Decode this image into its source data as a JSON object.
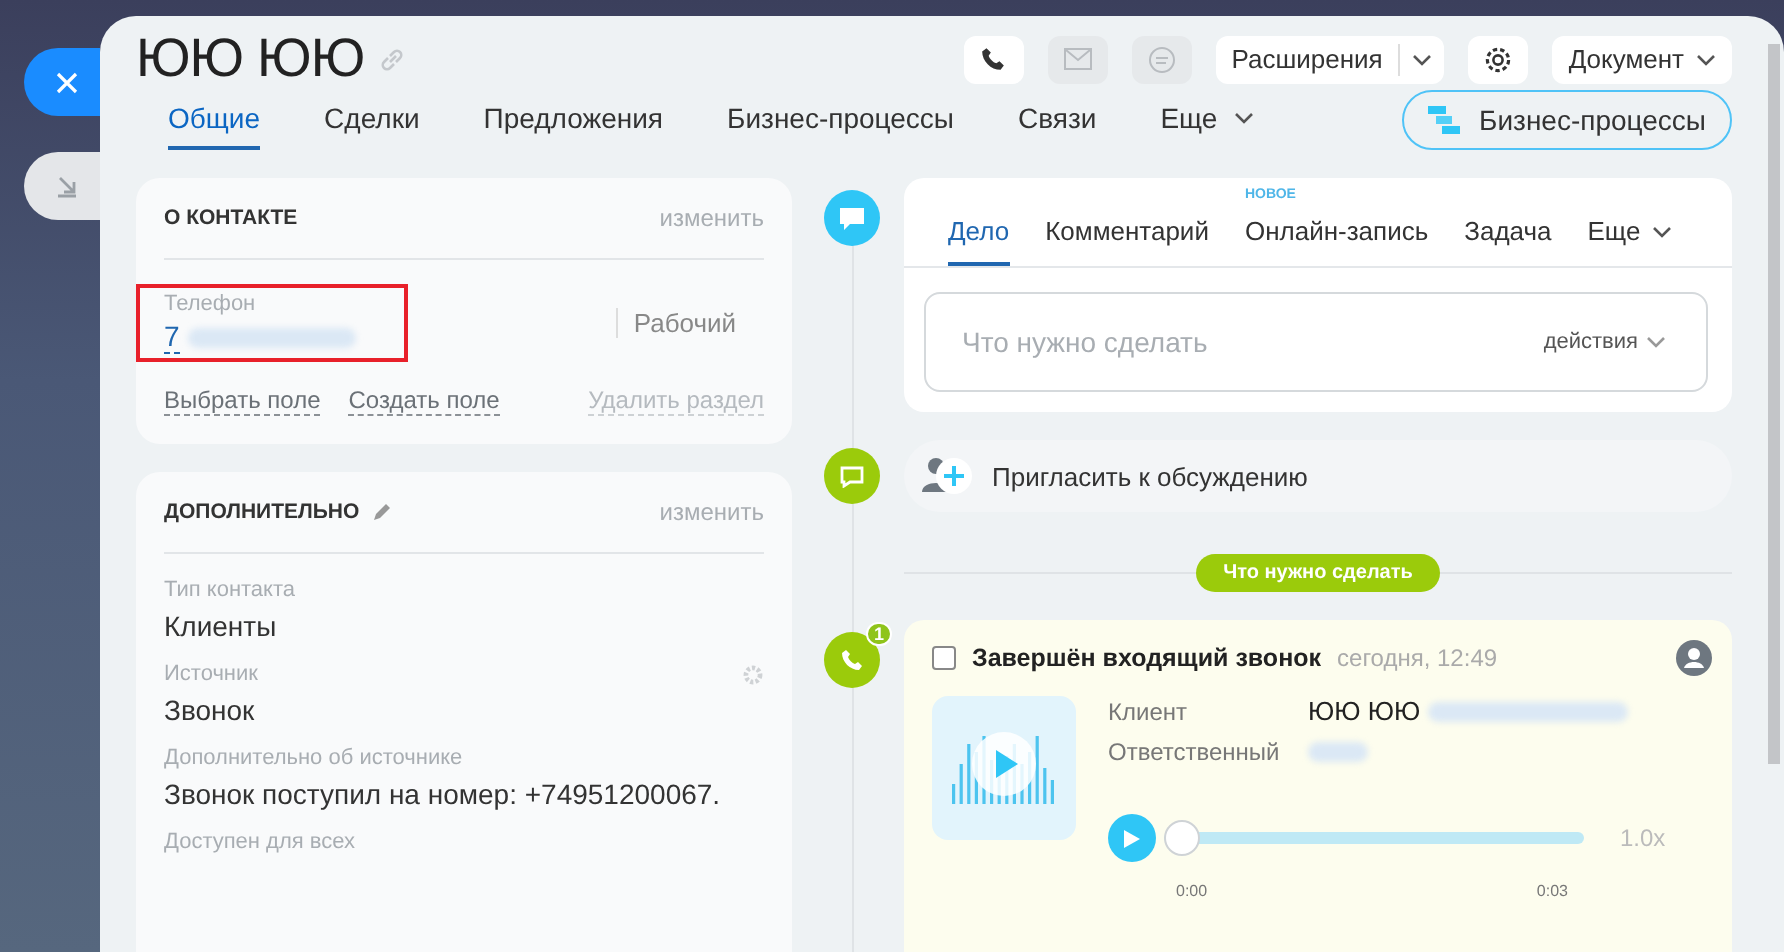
{
  "title": "ЮЮ ЮЮ",
  "header_actions": [
    {
      "kind": "phone",
      "disabled": false
    },
    {
      "kind": "mail",
      "disabled": true
    },
    {
      "kind": "chat",
      "disabled": true
    }
  ],
  "extensions_button": "Расширения",
  "document_button": "Документ",
  "tabs": [
    {
      "label": "Общие",
      "selected": true
    },
    {
      "label": "Сделки",
      "selected": false
    },
    {
      "label": "Предложения",
      "selected": false
    },
    {
      "label": "Бизнес-процессы",
      "selected": false
    },
    {
      "label": "Связи",
      "selected": false
    }
  ],
  "more_tab": "Еще",
  "bp_button": "Бизнес-процессы",
  "contact_card": {
    "title": "О КОНТАКТЕ",
    "edit": "изменить",
    "field_label": "Телефон",
    "phone_visible": "7",
    "phone_type": "Рабочий",
    "links": [
      "Выбрать поле",
      "Создать поле"
    ],
    "delete_link": "Удалить раздел"
  },
  "extra_card": {
    "title": "ДОПОЛНИТЕЛЬНО",
    "edit": "изменить",
    "fields": [
      {
        "label": "Тип контакта",
        "value": "Клиенты"
      },
      {
        "label": "Источник",
        "value": "Звонок"
      },
      {
        "label": "Дополнительно об источнике",
        "value": "Звонок поступил на номер: +74951200067."
      },
      {
        "label": "Доступен для всех"
      }
    ]
  },
  "composer": {
    "tabs": [
      {
        "label": "Дело",
        "selected": true
      },
      {
        "label": "Комментарий",
        "selected": false
      },
      {
        "label": "Онлайн-запись",
        "selected": false,
        "badge": "НОВОЕ"
      },
      {
        "label": "Задача",
        "selected": false
      }
    ],
    "more": "Еще",
    "placeholder": "Что нужно сделать",
    "actions": "действия"
  },
  "invite": "Пригласить к обсуждению",
  "divider_label": "Что нужно сделать",
  "call": {
    "counter": "1",
    "checked": false,
    "title": "Завершён входящий звонок",
    "time": "сегодня, 12:49",
    "client_label": "Клиент",
    "client_name": "ЮЮ ЮЮ",
    "responsible_label": "Ответственный",
    "level": 0,
    "start": "0:00",
    "end": "0:03",
    "speed": "1.0x"
  }
}
